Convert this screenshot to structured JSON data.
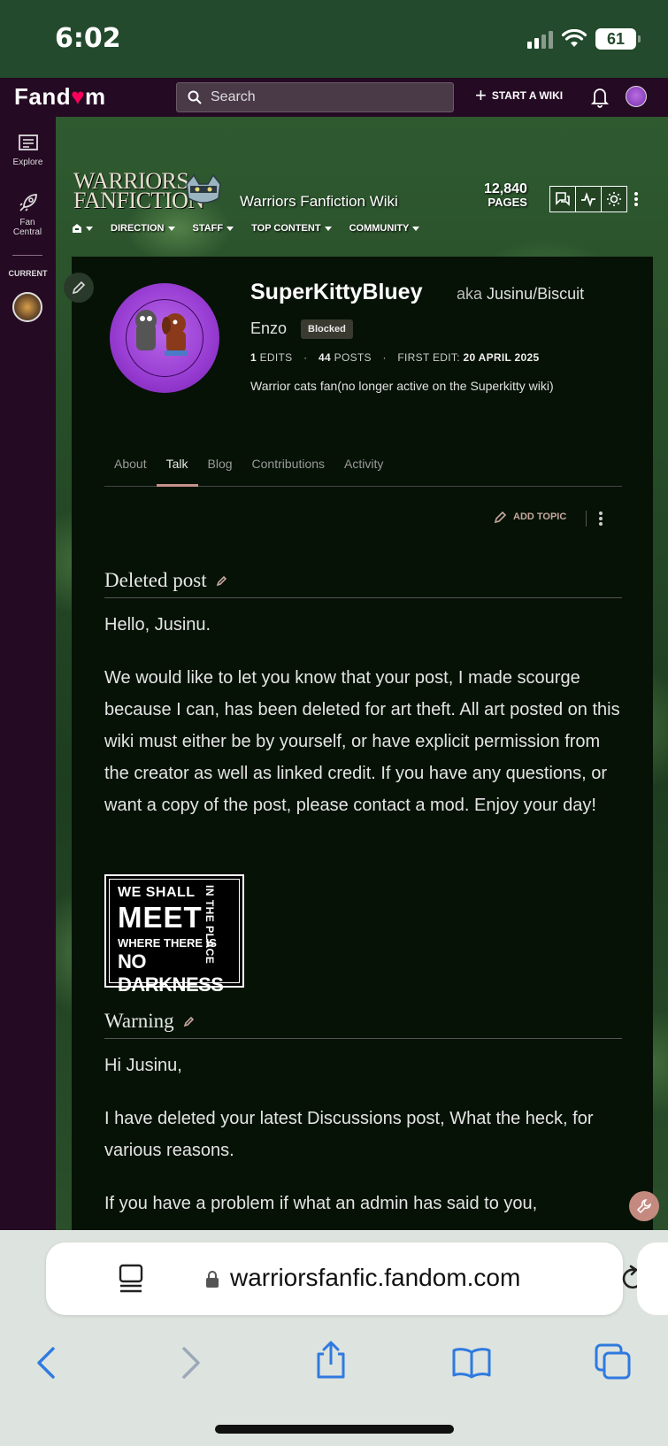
{
  "status_bar": {
    "time": "6:02",
    "battery": "61"
  },
  "fandom_nav": {
    "logo_text": "Fandom",
    "search_placeholder": "Search",
    "start_wiki": "START A WIKI"
  },
  "left_rail": {
    "explore": "Explore",
    "fan_central": "Fan Central",
    "current": "CURRENT"
  },
  "wiki": {
    "wordmark_line1": "WARRIORS",
    "wordmark_line2": "FANFICTION",
    "name": "Warriors Fanfiction Wiki",
    "pages_count": "12,840",
    "pages_label": "PAGES",
    "menu": [
      "DIRECTION",
      "STAFF",
      "TOP CONTENT",
      "COMMUNITY"
    ]
  },
  "profile": {
    "username": "SuperKittyBluey",
    "aka_prefix": "aka",
    "aka_line1": "Jusinu/Biscuit",
    "aka_line2": "Enzo",
    "badge": "Blocked",
    "edits_count": "1",
    "edits_label": "EDITS",
    "posts_count": "44",
    "posts_label": "POSTS",
    "first_edit_label": "FIRST EDIT:",
    "first_edit_date": "20 APRIL 2025",
    "bio": "Warrior cats fan(no longer active on the Superkitty wiki)"
  },
  "tabs": [
    {
      "label": "About",
      "active": false
    },
    {
      "label": "Talk",
      "active": true
    },
    {
      "label": "Blog",
      "active": false
    },
    {
      "label": "Contributions",
      "active": false
    },
    {
      "label": "Activity",
      "active": false
    }
  ],
  "add_topic": "ADD TOPIC",
  "sections": [
    {
      "heading": "Deleted post",
      "paragraphs": [
        "Hello, Jusinu.",
        "We would like to let you know that your post, I made scourge because I can, has been deleted for art theft. All art posted on this wiki must either be by yourself, or have explicit permission from the creator as well as linked credit. If you have any questions, or want a copy of the post, please contact a mod. Enjoy your day!"
      ]
    },
    {
      "heading": "Warning",
      "paragraphs": [
        "Hi Jusinu,",
        "I have deleted your latest Discussions post, What the heck, for various reasons.",
        "If you have a problem if what an admin has said to you,"
      ]
    }
  ],
  "signature": {
    "line1": "WE SHALL",
    "line2": "MEET",
    "side": "IN THE PLACE",
    "line3": "WHERE THERE IS",
    "line4": "NO DARKNESS"
  },
  "safari": {
    "url": "warriorsfanfic.fandom.com"
  },
  "colors": {
    "fandom_bar": "#250a23",
    "content_bg": "#061206",
    "accent": "#c4948a",
    "status_bg": "#234a2c"
  }
}
